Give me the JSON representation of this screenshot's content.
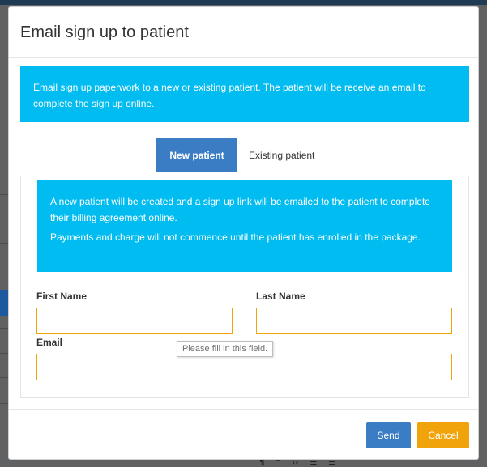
{
  "modal": {
    "title": "Email sign up to patient",
    "info": "Email sign up paperwork to a new or existing patient. The patient will be receive an email to complete the sign up online."
  },
  "tabs": [
    {
      "label": "New patient",
      "active": true
    },
    {
      "label": "Existing patient",
      "active": false
    }
  ],
  "panel": {
    "info_line1": "A new patient will be created and a sign up link will be emailed to the patient to complete their billing agreement online.",
    "info_line2": "Payments and charge will not commence until the patient has enrolled in the package."
  },
  "form": {
    "first_name_label": "First Name",
    "first_name_value": "",
    "last_name_label": "Last Name",
    "last_name_value": "",
    "email_label": "Email",
    "email_value": "",
    "validation_tooltip": "Please fill in this field."
  },
  "footer": {
    "send_label": "Send",
    "cancel_label": "Cancel"
  },
  "colors": {
    "info_banner": "#00bcf0",
    "primary": "#3b7dc4",
    "warning": "#f0a30a",
    "overlay": "#5f6163"
  }
}
